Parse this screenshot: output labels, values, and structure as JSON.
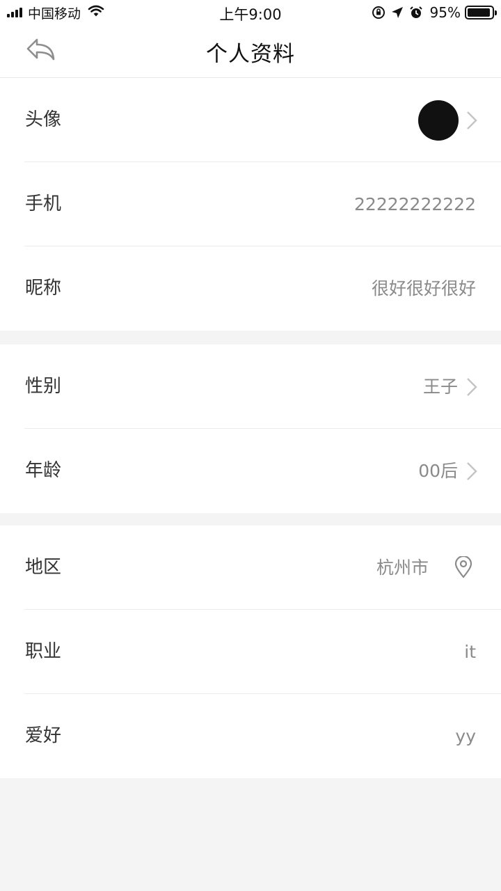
{
  "status_bar": {
    "carrier": "中国移动",
    "time": "上午9:00",
    "battery": "95%",
    "battery_level": 0.95,
    "icons": [
      "signal-icon",
      "wifi-icon",
      "orientation-lock-icon",
      "location-arrow-icon",
      "alarm-icon",
      "battery-icon"
    ]
  },
  "header": {
    "title": "个人资料",
    "back_icon": "back-arrow-icon"
  },
  "profile": {
    "avatar": {
      "label": "头像"
    },
    "phone": {
      "label": "手机",
      "value": "22222222222"
    },
    "nickname": {
      "label": "昵称",
      "value": "很好很好很好"
    },
    "gender": {
      "label": "性别",
      "value": "王子"
    },
    "age": {
      "label": "年龄",
      "value": "00后"
    },
    "region": {
      "label": "地区",
      "value": "杭州市",
      "icon": "location-pin-icon"
    },
    "occupation": {
      "label": "职业",
      "value": "it"
    },
    "hobby": {
      "label": "爱好",
      "value": "yy"
    }
  },
  "colors": {
    "background": "#f4f4f4",
    "surface": "#ffffff",
    "label": "#333333",
    "value": "#8a8a8a",
    "divider": "#ebebeb",
    "avatar": "#111111"
  }
}
